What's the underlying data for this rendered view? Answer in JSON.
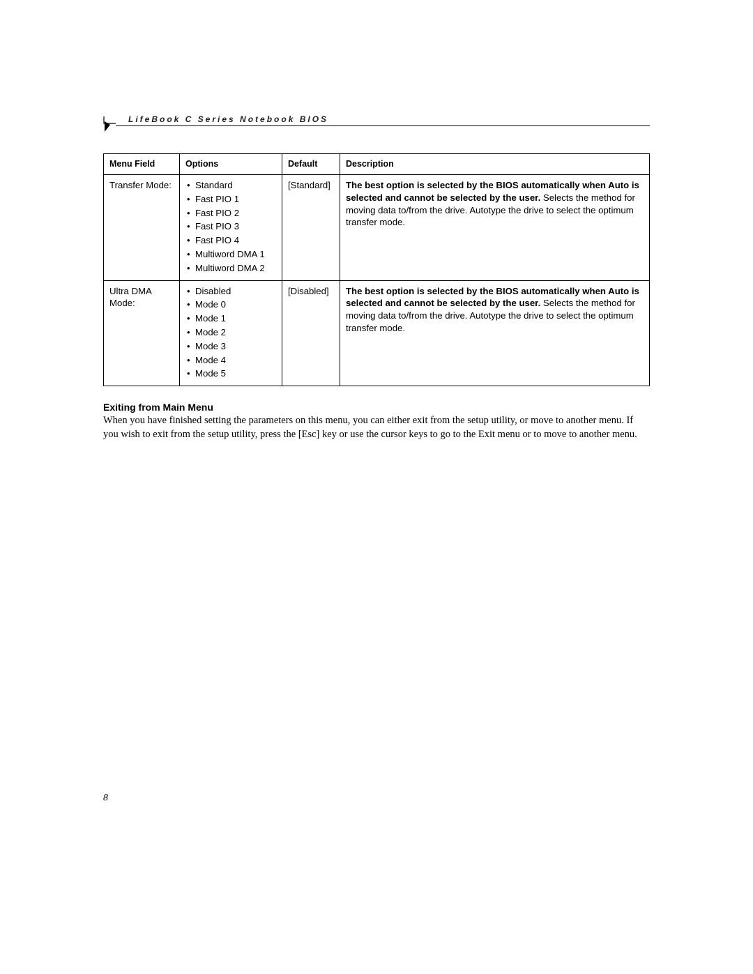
{
  "header": {
    "title": "LifeBook C Series Notebook BIOS"
  },
  "page_number": "8",
  "table": {
    "columns": [
      "Menu Field",
      "Options",
      "Default",
      "Description"
    ],
    "rows": [
      {
        "menu_field": "Transfer Mode:",
        "options": [
          "Standard",
          "Fast PIO 1",
          "Fast PIO 2",
          "Fast PIO 3",
          "Fast PIO 4",
          "Multiword DMA 1",
          "Multiword DMA 2"
        ],
        "default": "[Standard]",
        "desc_bold": "The best option is selected by the BIOS automatically when Auto is selected and cannot be selected by the user.",
        "desc_rest": " Selects the method for moving data to/from the drive. Autotype the drive to select the optimum transfer mode."
      },
      {
        "menu_field": "Ultra DMA Mode:",
        "options": [
          "Disabled",
          "Mode 0",
          "Mode 1",
          "Mode 2",
          "Mode 3",
          "Mode 4",
          "Mode 5"
        ],
        "default": "[Disabled]",
        "desc_bold": "The best option is selected by the BIOS automatically when Auto is selected and cannot be selected by the user.",
        "desc_rest": " Selects the method for moving data to/from the drive. Autotype the drive to select the optimum transfer mode."
      }
    ]
  },
  "section": {
    "title": "Exiting from Main Menu",
    "body": "When you have finished setting the parameters on this menu, you can either exit from the setup utility, or move to another menu. If you wish to exit from the setup utility, press the [Esc] key or use the cursor keys to go to the Exit menu or to move to another menu."
  }
}
